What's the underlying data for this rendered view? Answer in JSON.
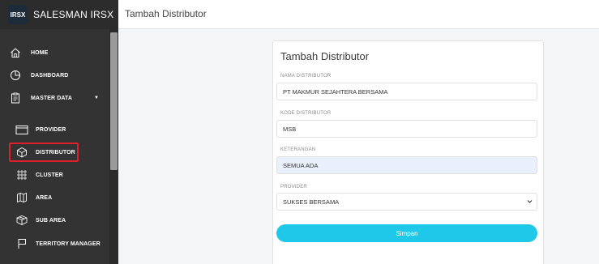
{
  "app": {
    "title": "SALESMAN IRSX",
    "logo_text": "IRSX"
  },
  "header": {
    "title": "Tambah Distributor"
  },
  "sidebar": {
    "items": [
      {
        "label": "HOME",
        "icon": "home-icon"
      },
      {
        "label": "DASHBOARD",
        "icon": "pie-chart-icon"
      },
      {
        "label": "MASTER DATA",
        "icon": "clipboard-icon",
        "expanded": true
      },
      {
        "label": "PROVIDER",
        "icon": "window-icon"
      },
      {
        "label": "DISTRIBUTOR",
        "icon": "box-icon",
        "active": true
      },
      {
        "label": "CLUSTER",
        "icon": "grid-dots-icon"
      },
      {
        "label": "AREA",
        "icon": "map-icon"
      },
      {
        "label": "SUB AREA",
        "icon": "boxes-icon"
      },
      {
        "label": "TERRITORY MANAGER",
        "icon": "flag-icon"
      }
    ],
    "caret": "▼"
  },
  "form": {
    "title": "Tambah Distributor",
    "fields": [
      {
        "label": "NAMA DISTRIBUTOR",
        "value": "PT  MAKMUR SEJAHTERA BERSAMA"
      },
      {
        "label": "KODE DISTRIBUTOR",
        "value": "MSB"
      },
      {
        "label": "KETERANGAN",
        "value": "SEMUA ADA"
      },
      {
        "label": "PROVIDER",
        "value": "SUKSES BERSAMA",
        "type": "select"
      }
    ],
    "submit_label": "Simpan"
  },
  "colors": {
    "sidebar": "#333333",
    "accent": "#1ec8e8",
    "highlight": "#e01f2a"
  }
}
